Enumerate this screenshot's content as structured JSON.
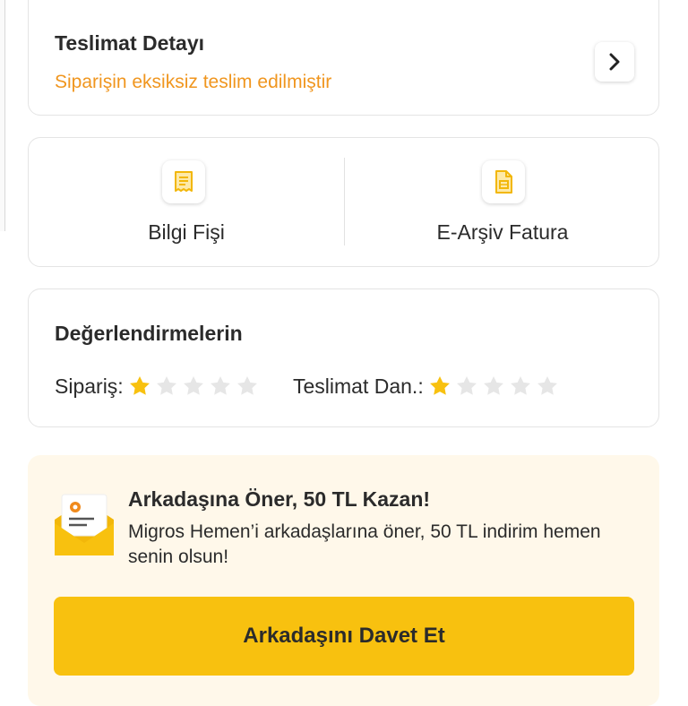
{
  "delivery": {
    "title": "Teslimat Detayı",
    "status": "Siparişin eksiksiz teslim edilmiştir",
    "status_color": "#f0961f",
    "action_icon": "chevron-right-icon"
  },
  "documents": [
    {
      "label": "Bilgi Fişi",
      "icon": "receipt-icon"
    },
    {
      "label": "E-Arşiv Fatura",
      "icon": "invoice-document-icon"
    }
  ],
  "ratings": {
    "title": "Değerlendirmelerin",
    "items": [
      {
        "label": "Sipariş:",
        "rating": 1,
        "max": 5
      },
      {
        "label": "Teslimat Dan.:",
        "rating": 1,
        "max": 5
      }
    ],
    "star_filled_color": "#f8c10f",
    "star_empty_color": "#e6e6e6"
  },
  "referral": {
    "title": "Arkadaşına Öner, 50 TL Kazan!",
    "description": "Migros Hemen’i arkadaşlarına öner, 50 TL indirim hemen senin olsun!",
    "button_label": "Arkadaşını Davet Et",
    "icon": "envelope-letter-icon",
    "button_color": "#f8c10f",
    "background_color": "#fff8ea"
  }
}
